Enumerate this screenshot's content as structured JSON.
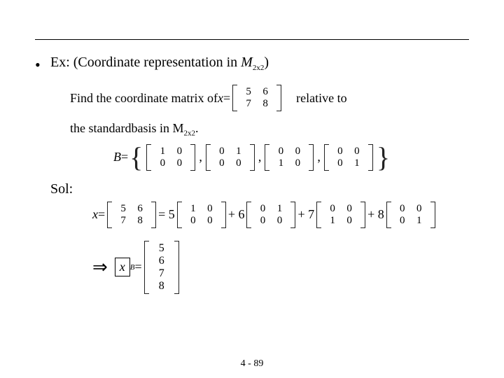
{
  "title": {
    "prefix": "Ex: (Coordinate representation in ",
    "space": "M",
    "space_sub": "2x2",
    "suffix": ")"
  },
  "line_find": {
    "t1": "Find the coordinate matrix of  ",
    "xvar": "x",
    "eq": " = ",
    "relative": "relative to"
  },
  "x_matrix": {
    "r1": [
      "5",
      "6"
    ],
    "r2": [
      "7",
      "8"
    ]
  },
  "line_basis": {
    "t1": "the standardbasis in M",
    "sub": "2x2",
    "t2": "."
  },
  "basis": {
    "label": "B",
    "eq": " = ",
    "mats": [
      {
        "r1": [
          "1",
          "0"
        ],
        "r2": [
          "0",
          "0"
        ]
      },
      {
        "r1": [
          "0",
          "1"
        ],
        "r2": [
          "0",
          "0"
        ]
      },
      {
        "r1": [
          "0",
          "0"
        ],
        "r2": [
          "1",
          "0"
        ]
      },
      {
        "r1": [
          "0",
          "0"
        ],
        "r2": [
          "0",
          "1"
        ]
      }
    ]
  },
  "sol_label": "Sol:",
  "expansion": {
    "xvar": "x",
    "eq": " = ",
    "coeffs": [
      "5",
      "6",
      "7",
      "8"
    ],
    "eq5": " = 5",
    "plus6": " + 6",
    "plus7": " + 7",
    "plus8": " + 8"
  },
  "result": {
    "imply": "⇒",
    "x": "x",
    "B": "B",
    "eq": " = ",
    "vec": [
      "5",
      "6",
      "7",
      "8"
    ]
  },
  "footer": "4 - 89"
}
